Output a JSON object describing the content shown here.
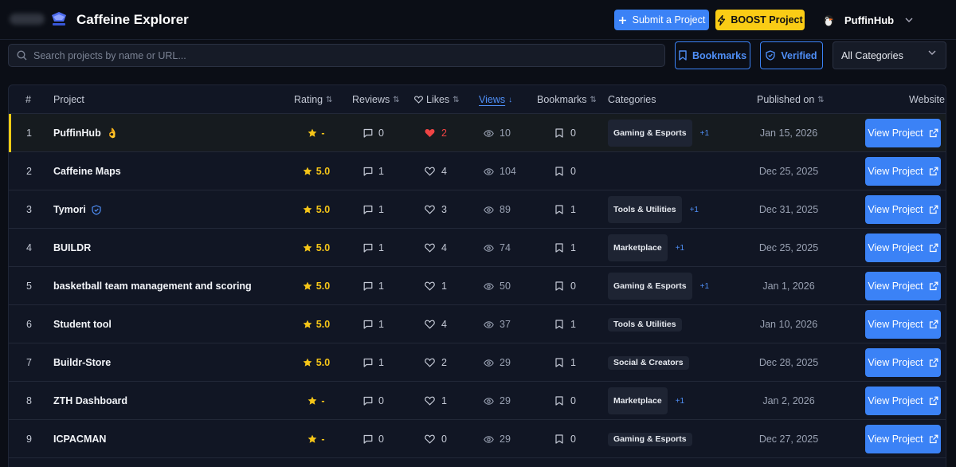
{
  "header": {
    "brand": "Caffeine Explorer",
    "submit_label": "Submit a Project",
    "boost_label": "BOOST Project",
    "user_name": "PuffinHub"
  },
  "toolbar": {
    "search_placeholder": "Search projects by name or URL...",
    "bookmarks_label": "Bookmarks",
    "verified_label": "Verified",
    "category_selected": "All Categories"
  },
  "table": {
    "columns": {
      "num": "#",
      "project": "Project",
      "rating": "Rating",
      "reviews": "Reviews",
      "likes": "Likes",
      "views": "Views",
      "bookmarks": "Bookmarks",
      "categories": "Categories",
      "published": "Published on",
      "website": "Website"
    },
    "view_label": "View Project",
    "rows": [
      {
        "num": "1",
        "name": "PuffinHub",
        "badge": "👌",
        "rating": "-",
        "reviews": "0",
        "likes": "2",
        "liked": true,
        "views": "10",
        "bookmarks": "0",
        "category": "Gaming & Esports",
        "extra": "+1",
        "tall": true,
        "date": "Jan 15, 2026"
      },
      {
        "num": "2",
        "name": "Caffeine Maps",
        "badge": "",
        "rating": "5.0",
        "reviews": "1",
        "likes": "4",
        "liked": false,
        "views": "104",
        "bookmarks": "0",
        "category": "",
        "extra": "",
        "tall": false,
        "date": "Dec 25, 2025"
      },
      {
        "num": "3",
        "name": "Tymori",
        "badge": "verified",
        "rating": "5.0",
        "reviews": "1",
        "likes": "3",
        "liked": false,
        "views": "89",
        "bookmarks": "1",
        "category": "Tools & Utilities",
        "extra": "+1",
        "tall": true,
        "date": "Dec 31, 2025"
      },
      {
        "num": "4",
        "name": "BUILDR",
        "badge": "",
        "rating": "5.0",
        "reviews": "1",
        "likes": "4",
        "liked": false,
        "views": "74",
        "bookmarks": "1",
        "category": "Marketplace",
        "extra": "+1",
        "tall": true,
        "date": "Dec 25, 2025"
      },
      {
        "num": "5",
        "name": "basketball team management and scoring",
        "badge": "",
        "rating": "5.0",
        "reviews": "1",
        "likes": "1",
        "liked": false,
        "views": "50",
        "bookmarks": "0",
        "category": "Gaming & Esports",
        "extra": "+1",
        "tall": true,
        "date": "Jan 1, 2026"
      },
      {
        "num": "6",
        "name": "Student tool",
        "badge": "",
        "rating": "5.0",
        "reviews": "1",
        "likes": "4",
        "liked": false,
        "views": "37",
        "bookmarks": "1",
        "category": "Tools & Utilities",
        "extra": "",
        "tall": false,
        "date": "Jan 10, 2026"
      },
      {
        "num": "7",
        "name": "Buildr-Store",
        "badge": "",
        "rating": "5.0",
        "reviews": "1",
        "likes": "2",
        "liked": false,
        "views": "29",
        "bookmarks": "1",
        "category": "Social & Creators",
        "extra": "",
        "tall": false,
        "date": "Dec 28, 2025"
      },
      {
        "num": "8",
        "name": "ZTH Dashboard",
        "badge": "",
        "rating": "-",
        "reviews": "0",
        "likes": "1",
        "liked": false,
        "views": "29",
        "bookmarks": "0",
        "category": "Marketplace",
        "extra": "+1",
        "tall": true,
        "date": "Jan 2, 2026"
      },
      {
        "num": "9",
        "name": "ICPACMAN",
        "badge": "",
        "rating": "-",
        "reviews": "0",
        "likes": "0",
        "liked": false,
        "views": "29",
        "bookmarks": "0",
        "category": "Gaming & Esports",
        "extra": "",
        "tall": false,
        "date": "Dec 27, 2025"
      }
    ]
  },
  "colors": {
    "accent": "#3b82f6",
    "boost": "#facc15",
    "like": "#ef4444",
    "star": "#f5c518",
    "background": "#0b0e16"
  }
}
